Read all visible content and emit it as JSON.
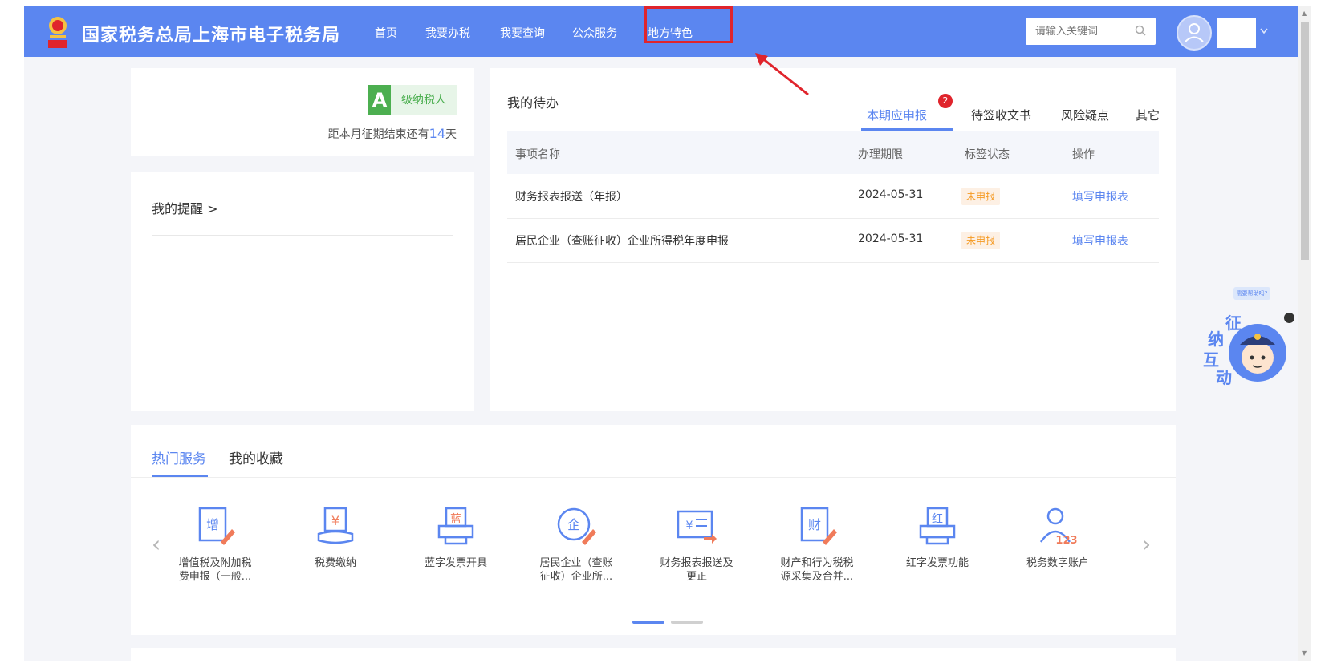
{
  "header": {
    "site_title": "国家税务总局上海市电子税务局",
    "nav": [
      "首页",
      "我要办税",
      "我要查询",
      "公众服务",
      "地方特色"
    ],
    "search_placeholder": "请输入关键词"
  },
  "profile": {
    "grade_letter": "A",
    "grade_label": "级纳税人",
    "countdown_prefix": "距本月征期结束还有",
    "countdown_days": "14",
    "countdown_suffix": "天"
  },
  "reminder": {
    "title": "我的提醒 >"
  },
  "todo": {
    "title": "我的待办",
    "tabs": [
      "本期应申报",
      "待签收文书",
      "风险疑点",
      "其它"
    ],
    "badge_count": "2",
    "columns": [
      "事项名称",
      "办理期限",
      "标签状态",
      "操作"
    ],
    "rows": [
      {
        "name": "财务报表报送（年报）",
        "deadline": "2024-05-31",
        "status": "未申报",
        "action": "填写申报表"
      },
      {
        "name": "居民企业（查账征收）企业所得税年度申报",
        "deadline": "2024-05-31",
        "status": "未申报",
        "action": "填写申报表"
      }
    ]
  },
  "services": {
    "tabs": [
      "热门服务",
      "我的收藏"
    ],
    "prev_arrow": "‹",
    "next_arrow": "›",
    "items": [
      {
        "label_line1": "增值税及附加税",
        "label_line2": "费申报（一般...",
        "icon": "vat-return-icon",
        "glyph": "增"
      },
      {
        "label_line1": "税费缴纳",
        "label_line2": "",
        "icon": "tax-payment-icon",
        "glyph": "¥"
      },
      {
        "label_line1": "蓝字发票开具",
        "label_line2": "",
        "icon": "blue-invoice-icon",
        "glyph": "蓝"
      },
      {
        "label_line1": "居民企业（查账",
        "label_line2": "征收）企业所...",
        "icon": "enterprise-tax-icon",
        "glyph": "企"
      },
      {
        "label_line1": "财务报表报送及",
        "label_line2": "更正",
        "icon": "financial-report-icon",
        "glyph": "¥"
      },
      {
        "label_line1": "财产和行为税税",
        "label_line2": "源采集及合并...",
        "icon": "property-tax-icon",
        "glyph": "财"
      },
      {
        "label_line1": "红字发票功能",
        "label_line2": "",
        "icon": "red-invoice-icon",
        "glyph": "红"
      },
      {
        "label_line1": "税务数字账户",
        "label_line2": "",
        "icon": "digital-account-icon",
        "glyph": "123"
      }
    ]
  },
  "assistant": {
    "bubble_text": "需要帮助吗?",
    "chars": [
      "纳",
      "征",
      "互",
      "动"
    ]
  },
  "colors": {
    "primary": "#5b86f0",
    "highlight_box": "#e0242c",
    "grade_green": "#4caf50",
    "status_orange": "#f59a23"
  }
}
